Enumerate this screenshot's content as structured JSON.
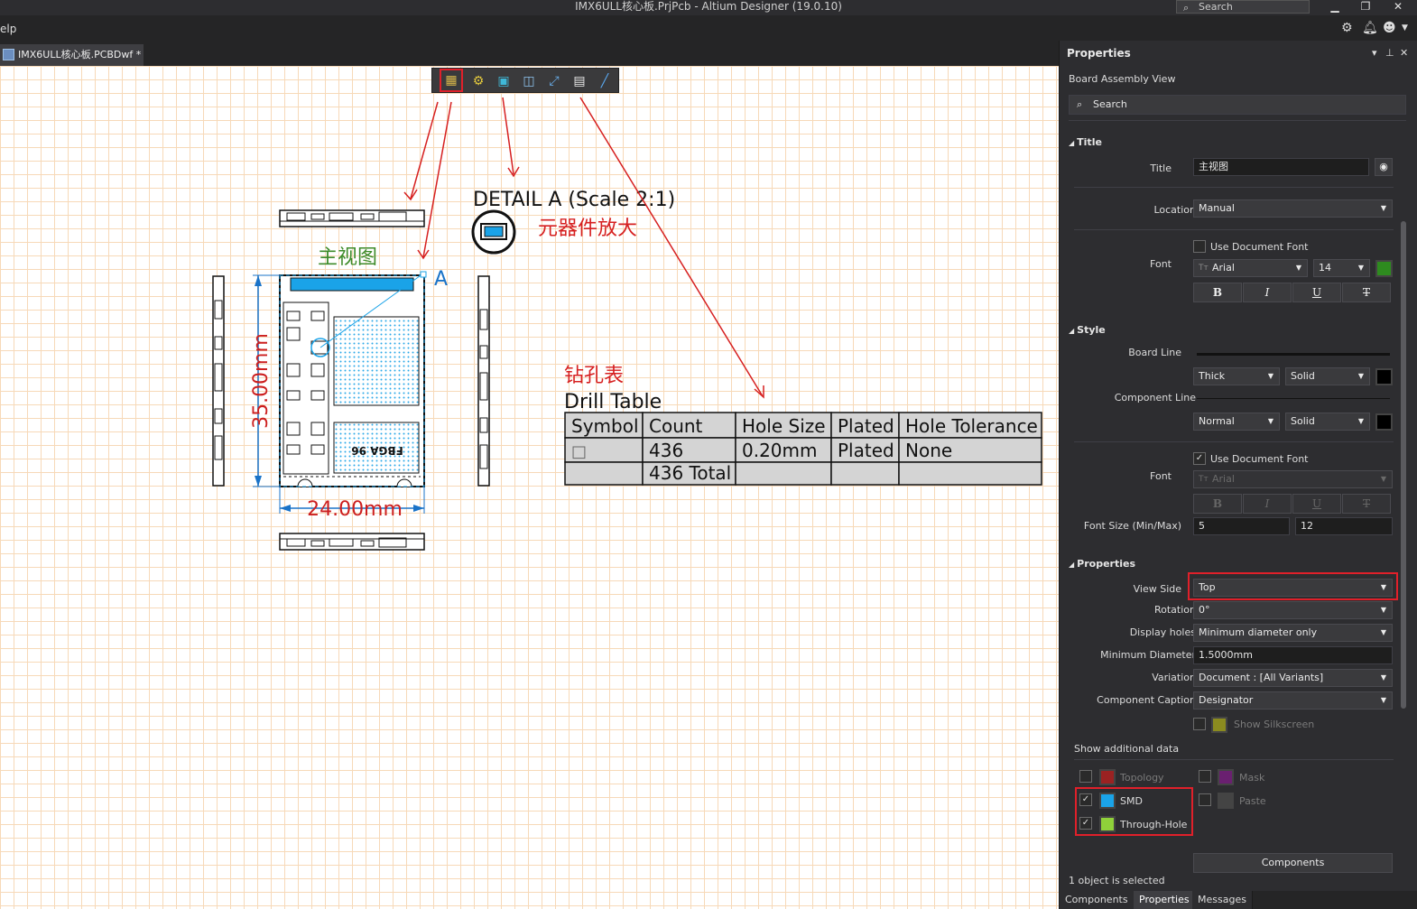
{
  "window": {
    "title": "IMX6ULL核心板.PrjPcb - Altium Designer (19.0.10)",
    "search_label": "Search"
  },
  "menu": {
    "help_label": "elp"
  },
  "document_tab": {
    "label": "IMX6ULL核心板.PCBDwf *"
  },
  "canvas": {
    "detail_title": "DETAIL A (Scale 2:1)",
    "annotation_enlarge": "元器件放大",
    "main_view_label": "主视图",
    "detail_marker": "A",
    "dim_height": "35.00mm",
    "dim_width": "24.00mm",
    "chip_marking": "FBGA 96",
    "drill_title_cn": "钻孔表",
    "drill_title_en": "Drill Table",
    "drill_table": {
      "headers": [
        "Symbol",
        "Count",
        "Hole Size",
        "Plated",
        "Hole Tolerance"
      ],
      "rows": [
        [
          "□",
          "436",
          "0.20mm",
          "Plated",
          "None"
        ],
        [
          "",
          "436 Total",
          "",
          "",
          ""
        ]
      ]
    }
  },
  "panel": {
    "title": "Properties",
    "subtitle": "Board Assembly View",
    "search_placeholder": "Search",
    "sections": {
      "title": "Title",
      "style": "Style",
      "properties": "Properties"
    },
    "title_section": {
      "title_label": "Title",
      "title_value": "主视图",
      "location_label": "Location",
      "location_value": "Manual",
      "font_label": "Font",
      "use_doc_font_label": "Use Document Font",
      "use_doc_font_checked": false,
      "font_name": "Arial",
      "font_size": "14",
      "font_color": "#2e8b1f",
      "bold": "B",
      "italic": "I",
      "underline": "U",
      "strike": "T"
    },
    "style_section": {
      "board_line_label": "Board Line",
      "board_line_weight": "Thick",
      "board_line_style": "Solid",
      "board_line_color": "#000000",
      "component_line_label": "Component Line",
      "component_line_weight": "Normal",
      "component_line_style": "Solid",
      "component_line_color": "#000000",
      "use_doc_font_label": "Use Document Font",
      "use_doc_font_checked": true,
      "font_label": "Font",
      "font_name": "Arial",
      "font_size_label": "Font Size (Min/Max)",
      "font_size_min": "5",
      "font_size_max": "12"
    },
    "properties_section": {
      "view_side_label": "View Side",
      "view_side_value": "Top",
      "rotation_label": "Rotation",
      "rotation_value": "0°",
      "display_holes_label": "Display holes",
      "display_holes_value": "Minimum diameter only",
      "min_diameter_label": "Minimum Diameter",
      "min_diameter_value": "1.5000mm",
      "variation_label": "Variation",
      "variation_value": "Document : [All Variants]",
      "component_caption_label": "Component Caption",
      "component_caption_value": "Designator",
      "show_silkscreen_label": "Show Silkscreen",
      "show_silkscreen_color": "#8b8b1f",
      "show_additional_label": "Show additional data",
      "additional": [
        {
          "label": "Topology",
          "checked": false,
          "color": "#9b2222"
        },
        {
          "label": "SMD",
          "checked": true,
          "color": "#1aa3e8"
        },
        {
          "label": "Through-Hole",
          "checked": true,
          "color": "#8fd13a"
        },
        {
          "label": "Mask",
          "checked": false,
          "color": "#6a2070"
        },
        {
          "label": "Paste",
          "checked": false,
          "color": "#444444"
        }
      ],
      "components_button": "Components"
    },
    "status": "1 object is selected",
    "bottom_tabs": [
      "Components",
      "Properties",
      "Messages"
    ]
  }
}
